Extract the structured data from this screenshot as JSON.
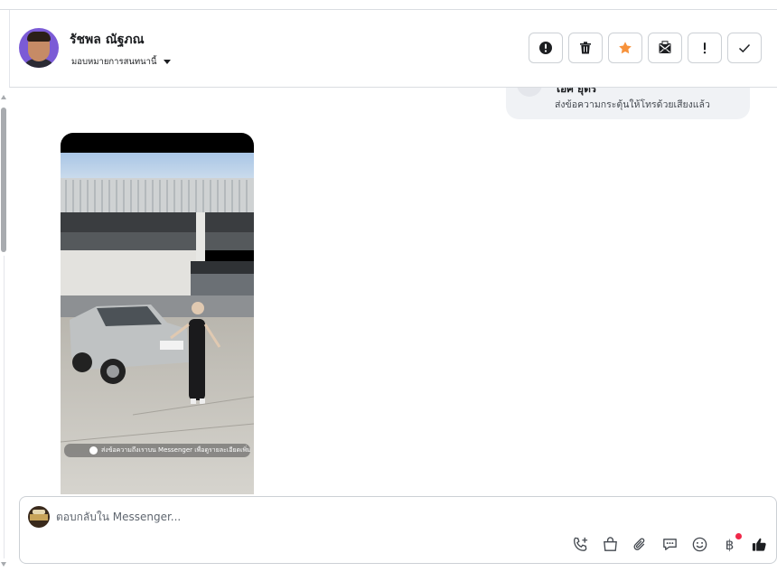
{
  "header": {
    "contact_name": "รัชพล ณัฐภณ",
    "assign_label": "มอบหมายการสนทนานี้",
    "actions": [
      {
        "name": "spam-icon"
      },
      {
        "name": "trash-icon"
      },
      {
        "name": "star-icon"
      },
      {
        "name": "mark-unread-icon"
      },
      {
        "name": "follow-up-icon"
      },
      {
        "name": "done-icon"
      }
    ]
  },
  "thread": {
    "call_bubble": {
      "title": "ไอศ ยุตร",
      "subtitle": "ส่งข้อความกระตุ้นให้โทรด้วยเสียงแล้ว"
    },
    "video": {
      "caption": "ส่งข้อความถึงเราบน Messenger เพื่อดูรายละเอียดเพิ่มเติม"
    }
  },
  "composer": {
    "placeholder": "ตอบกลับใน Messenger...",
    "value": "",
    "tools": [
      "call-add-icon",
      "bag-icon",
      "paperclip-icon",
      "quick-reply-icon",
      "emoji-icon",
      "baht-icon",
      "thumbs-up-icon"
    ],
    "baht_symbol": "฿"
  },
  "colors": {
    "star": "#f7923b",
    "notification_dot": "#f02849",
    "avatar_bg": "#7b5bd6"
  }
}
